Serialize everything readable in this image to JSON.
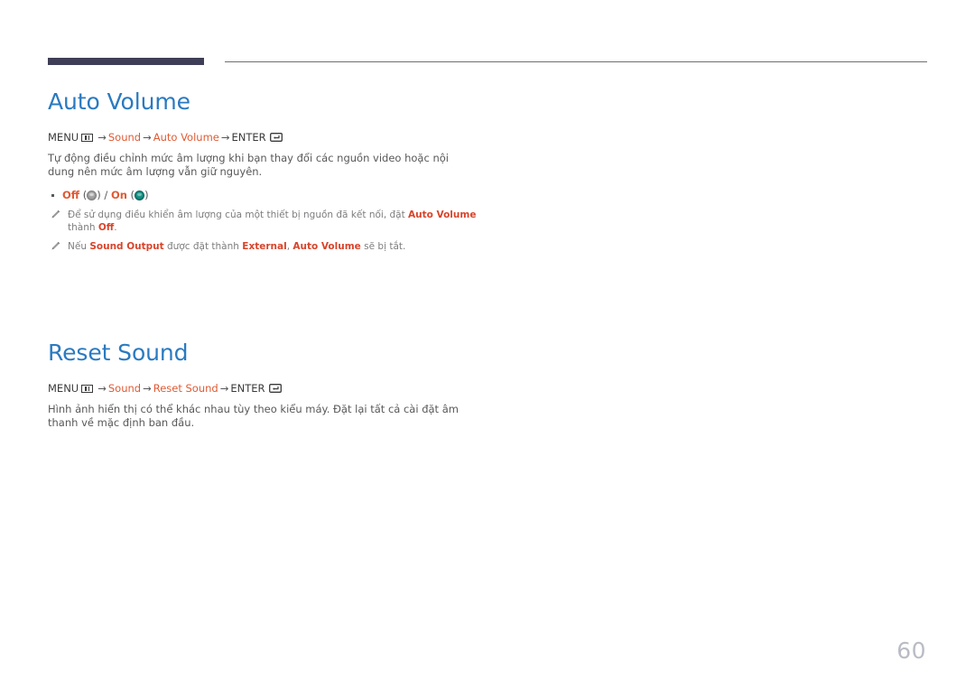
{
  "page": {
    "number": "60"
  },
  "header": {
    "rule_color_thick": "#3e3e56",
    "rule_color_thin": "#6f6f72"
  },
  "colors": {
    "heading": "#2a7ac0",
    "accent_orange": "#e05a33",
    "note_text": "#7d7d7f",
    "body_text": "#58585a",
    "radio_on": "#11867c",
    "radio_off": "#9a9a9a",
    "page_number": "#b9bcc4"
  },
  "sections": [
    {
      "title": "Auto Volume",
      "menu_path": {
        "menu_label": "MENU",
        "menu_icon": "menu-grid-icon",
        "arrow": "→",
        "items": [
          "Sound",
          "Auto Volume"
        ],
        "enter_label": "ENTER",
        "enter_icon": "enter-key-icon"
      },
      "description": "Tự động điều chỉnh mức âm lượng khi bạn thay đổi các nguồn video hoặc nội dung nên mức âm lượng vẫn giữ nguyên.",
      "options": {
        "off_label": "Off",
        "on_label": "On",
        "separator": "/",
        "off_state_icon": "radio-unselected-icon",
        "on_state_icon": "radio-selected-icon"
      },
      "notes": [
        {
          "icon": "pencil-note-icon",
          "parts": [
            {
              "text": "Để sử dụng điều khiển âm lượng của một thiết bị nguồn đã kết nối, đặt ",
              "style": "plain"
            },
            {
              "text": "Auto Volume",
              "style": "highlight"
            },
            {
              "text": " thành ",
              "style": "plain"
            },
            {
              "text": "Off",
              "style": "highlight"
            },
            {
              "text": ".",
              "style": "plain"
            }
          ]
        },
        {
          "icon": "pencil-note-icon",
          "parts": [
            {
              "text": "Nếu ",
              "style": "plain"
            },
            {
              "text": "Sound Output",
              "style": "highlight"
            },
            {
              "text": " được đặt thành ",
              "style": "plain"
            },
            {
              "text": "External",
              "style": "highlight"
            },
            {
              "text": ", ",
              "style": "plain"
            },
            {
              "text": "Auto Volume",
              "style": "highlight"
            },
            {
              "text": " sẽ bị tắt.",
              "style": "plain"
            }
          ]
        }
      ]
    },
    {
      "title": "Reset Sound",
      "menu_path": {
        "menu_label": "MENU",
        "menu_icon": "menu-grid-icon",
        "arrow": "→",
        "items": [
          "Sound",
          "Reset Sound"
        ],
        "enter_label": "ENTER",
        "enter_icon": "enter-key-icon"
      },
      "description": "Hình ảnh hiển thị có thể khác nhau tùy theo kiểu máy. Đặt lại tất cả cài đặt âm thanh về mặc định ban đầu.",
      "options": null,
      "notes": []
    }
  ]
}
